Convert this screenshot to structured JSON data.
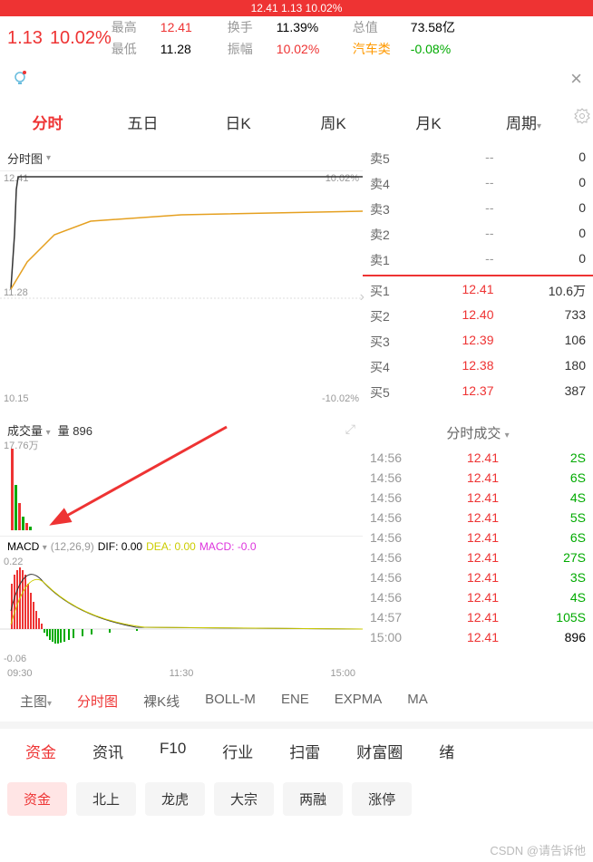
{
  "banner": "12.41 1.13 10.02%",
  "header": {
    "change": "1.13",
    "pct": "10.02%",
    "rows": [
      {
        "l1": "最高",
        "v1": "12.41",
        "l2": "换手",
        "v2": "11.39%",
        "l3": "总值",
        "v3": "73.58亿"
      },
      {
        "l1": "最低",
        "v1": "11.28",
        "l2": "振幅",
        "v2": "10.02%",
        "l3": "汽车类",
        "v3": "-0.08%"
      }
    ]
  },
  "tabs": [
    "分时",
    "五日",
    "日K",
    "周K",
    "月K",
    "周期"
  ],
  "chart_header": "分时图",
  "price_labels": {
    "top": "12.41",
    "topPct": "10.02%",
    "mid": "11.28",
    "bot": "10.15",
    "botPct": "-10.02%"
  },
  "orderbook": {
    "asks": [
      {
        "n": "卖5",
        "p": "--",
        "q": "0"
      },
      {
        "n": "卖4",
        "p": "--",
        "q": "0"
      },
      {
        "n": "卖3",
        "p": "--",
        "q": "0"
      },
      {
        "n": "卖2",
        "p": "--",
        "q": "0"
      },
      {
        "n": "卖1",
        "p": "--",
        "q": "0"
      }
    ],
    "bids": [
      {
        "n": "买1",
        "p": "12.41",
        "q": "10.6万"
      },
      {
        "n": "买2",
        "p": "12.40",
        "q": "733"
      },
      {
        "n": "买3",
        "p": "12.39",
        "q": "106"
      },
      {
        "n": "买4",
        "p": "12.38",
        "q": "180"
      },
      {
        "n": "买5",
        "p": "12.37",
        "q": "387"
      }
    ]
  },
  "vol": {
    "label": "成交量",
    "amount": "量 896",
    "max": "17.76万"
  },
  "trades_header": "分时成交",
  "trades": [
    {
      "t": "14:56",
      "p": "12.41",
      "q": "2",
      "s": "S"
    },
    {
      "t": "14:56",
      "p": "12.41",
      "q": "6",
      "s": "S"
    },
    {
      "t": "14:56",
      "p": "12.41",
      "q": "4",
      "s": "S"
    },
    {
      "t": "14:56",
      "p": "12.41",
      "q": "5",
      "s": "S"
    },
    {
      "t": "14:56",
      "p": "12.41",
      "q": "6",
      "s": "S"
    },
    {
      "t": "14:56",
      "p": "12.41",
      "q": "27",
      "s": "S"
    },
    {
      "t": "14:56",
      "p": "12.41",
      "q": "3",
      "s": "S"
    },
    {
      "t": "14:56",
      "p": "12.41",
      "q": "4",
      "s": "S"
    },
    {
      "t": "14:57",
      "p": "12.41",
      "q": "105",
      "s": "S"
    },
    {
      "t": "15:00",
      "p": "12.41",
      "q": "896",
      "s": ""
    }
  ],
  "macd": {
    "label": "MACD",
    "params": "(12,26,9)",
    "dif": "DIF: 0.00",
    "dea": "DEA: 0.00",
    "macd": "MACD: -0.0",
    "top": "0.22",
    "bot": "-0.06"
  },
  "time_axis": [
    "09:30",
    "11:30",
    "15:00"
  ],
  "indicator_tabs": [
    "主图",
    "分时图",
    "裸K线",
    "BOLL-M",
    "ENE",
    "EXPMA",
    "MA"
  ],
  "bottom_tabs": [
    "资金",
    "资讯",
    "F10",
    "行业",
    "扫雷",
    "财富圈",
    "绪"
  ],
  "chips": [
    "资金",
    "北上",
    "龙虎",
    "大宗",
    "两融",
    "涨停"
  ],
  "watermark": "CSDN @请告诉他",
  "chart_data": {
    "type": "line",
    "title": "分时图",
    "ylim": [
      10.15,
      12.41
    ],
    "x": [
      "09:30",
      "11:30",
      "15:00"
    ],
    "price_line": {
      "desc": "opens ~11.28, spikes to 12.41 (limit up) within first minutes, stays flat at 12.41 all day"
    },
    "avg_line": {
      "desc": "yellow average line rises from ~11.4 to ~12.3 gradually"
    },
    "volume": {
      "max": 17.76,
      "unit": "万",
      "desc": "large bars at open then near zero"
    },
    "macd": {
      "params": [
        12,
        26,
        9
      ],
      "range": [
        -0.06,
        0.22
      ],
      "dif": 0.0,
      "dea": 0.0,
      "macd": -0.0
    }
  }
}
